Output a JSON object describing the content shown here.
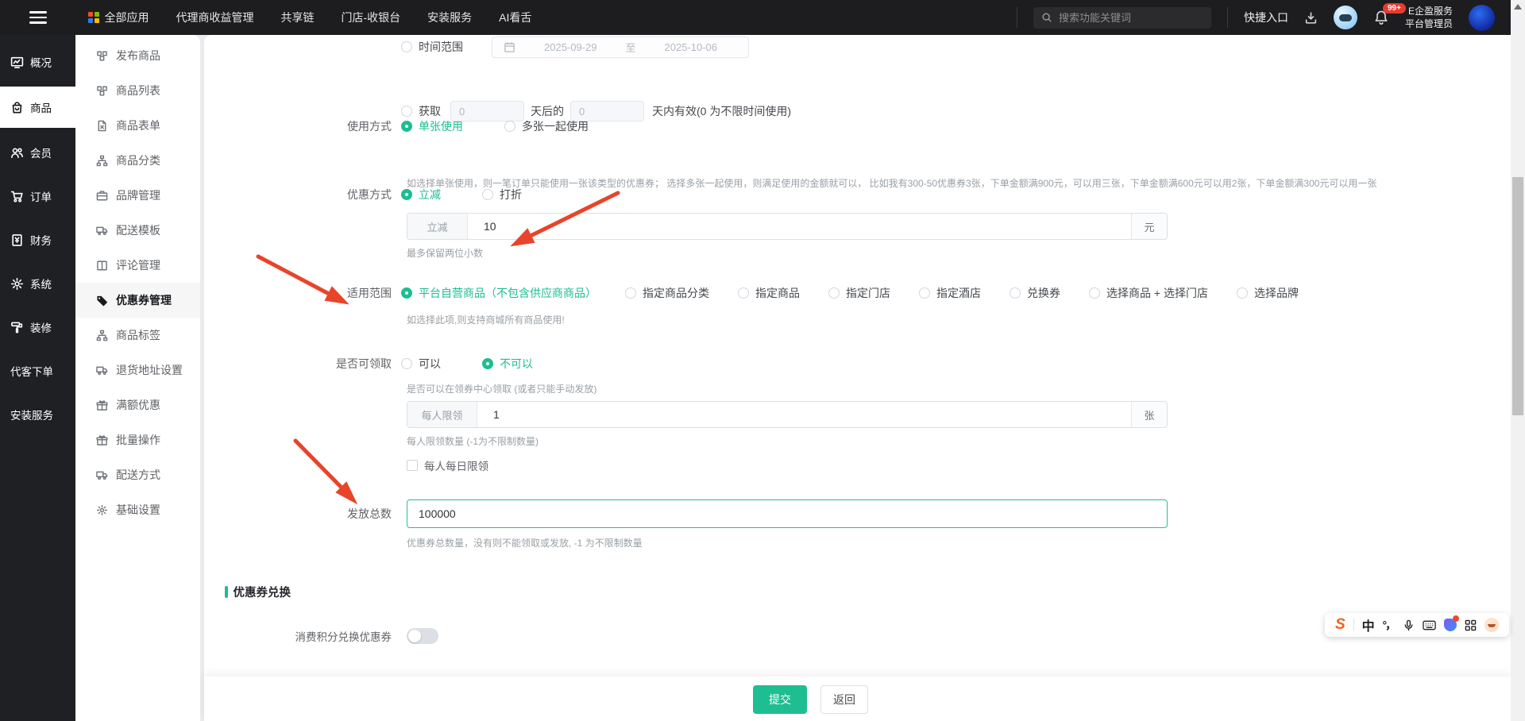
{
  "navbar": {
    "menu": [
      {
        "label": "全部应用",
        "icon": "app-grid"
      },
      {
        "label": "代理商收益管理"
      },
      {
        "label": "共享链"
      },
      {
        "label": "门店-收银台"
      },
      {
        "label": "安装服务"
      },
      {
        "label": "AI看舌"
      }
    ],
    "search_placeholder": "搜索功能关键词",
    "quick_entry": "快捷入口",
    "notification_badge": "99+",
    "user_org": "E企盈服务",
    "user_role": "平台管理员"
  },
  "rail": {
    "items": [
      {
        "label": "概况",
        "icon": "overview"
      },
      {
        "label": "商品",
        "icon": "goods",
        "active": true
      },
      {
        "label": "会员",
        "icon": "members"
      },
      {
        "label": "订单",
        "icon": "orders"
      },
      {
        "label": "财务",
        "icon": "finance"
      },
      {
        "label": "系统",
        "icon": "system"
      },
      {
        "label": "装修",
        "icon": "decorate"
      },
      {
        "label": "代客下单"
      },
      {
        "label": "安装服务"
      }
    ]
  },
  "sidebar": {
    "items": [
      {
        "label": "发布商品",
        "icon": "cubes"
      },
      {
        "label": "商品列表",
        "icon": "cubes"
      },
      {
        "label": "商品表单",
        "icon": "file"
      },
      {
        "label": "商品分类",
        "icon": "sitemap"
      },
      {
        "label": "品牌管理",
        "icon": "briefcase"
      },
      {
        "label": "配送模板",
        "icon": "truck"
      },
      {
        "label": "评论管理",
        "icon": "columns"
      },
      {
        "label": "优惠券管理",
        "icon": "tag",
        "active": true
      },
      {
        "label": "商品标签",
        "icon": "sitemap"
      },
      {
        "label": "退货地址设置",
        "icon": "truck"
      },
      {
        "label": "满额优惠",
        "icon": "gift"
      },
      {
        "label": "批量操作",
        "icon": "gift"
      },
      {
        "label": "配送方式",
        "icon": "truck"
      },
      {
        "label": "基础设置",
        "icon": "gear"
      }
    ]
  },
  "form": {
    "time_range": {
      "label": "时间范围",
      "start": "2025-09-29",
      "separator": "至",
      "end": "2025-10-06"
    },
    "acquire": {
      "label": "获取",
      "days_value": "0",
      "middle": "天后的",
      "valid_value": "0",
      "tail": "天内有效(0 为不限时间使用)"
    },
    "usage": {
      "label": "使用方式",
      "options": [
        "单张使用",
        "多张一起使用"
      ],
      "selected": 0,
      "help": "如选择单张使用，则一笔订单只能使用一张该类型的优惠券； 选择多张一起使用，则满足使用的金额就可以， 比如我有300-50优惠券3张，下单金额满900元，可以用三张，下单金额满600元可以用2张，下单金额满300元可以用一张"
    },
    "discount": {
      "label": "优惠方式",
      "options": [
        "立减",
        "打折"
      ],
      "selected": 0,
      "input_prefix": "立减",
      "input_value": "10",
      "input_suffix": "元",
      "hint": "最多保留两位小数"
    },
    "scope": {
      "label": "适用范围",
      "options": [
        "平台自营商品（不包含供应商商品）",
        "指定商品分类",
        "指定商品",
        "指定门店",
        "指定酒店",
        "兑换券",
        "选择商品 + 选择门店",
        "选择品牌"
      ],
      "selected": 0,
      "note": "如选择此项,则支持商城所有商品使用!"
    },
    "receivable": {
      "label": "是否可领取",
      "options": [
        "可以",
        "不可以"
      ],
      "selected": 1,
      "note": "是否可以在领券中心领取 (或者只能手动发放)"
    },
    "limit": {
      "input_prefix": "每人限领",
      "input_value": "1",
      "input_suffix": "张",
      "note": "每人限领数量 (-1为不限制数量)",
      "daily_label": "每人每日限领"
    },
    "total": {
      "label": "发放总数",
      "value": "100000",
      "note": "优惠券总数量，没有则不能领取或发放, -1 为不限制数量"
    },
    "exchange": {
      "section_title": "优惠券兑换",
      "toggle_label": "消费积分兑换优惠券",
      "toggle_on": false
    },
    "actions": {
      "submit": "提交",
      "back": "返回"
    }
  },
  "ime": {
    "mode": "中",
    "punctuation": "°，"
  },
  "colors": {
    "accent": "#1cbe92",
    "arrow": "#e8442a",
    "submit_green": "#1fbd92"
  }
}
